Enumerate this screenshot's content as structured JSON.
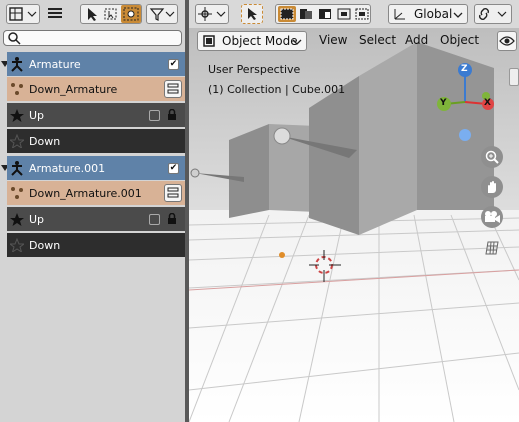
{
  "outliner": {
    "search_placeholder": "",
    "items": [
      {
        "label": "Armature",
        "kind": "armature"
      },
      {
        "label": "Down_Armature",
        "kind": "pose"
      },
      {
        "label": "Up",
        "kind": "bone"
      },
      {
        "label": "Down",
        "kind": "bone"
      },
      {
        "label": "Armature.001",
        "kind": "armature"
      },
      {
        "label": "Down_Armature.001",
        "kind": "pose"
      },
      {
        "label": "Up",
        "kind": "bone"
      },
      {
        "label": "Down",
        "kind": "bone"
      }
    ]
  },
  "viewport_header": {
    "orientation": "Global",
    "mode": "Object Mode",
    "menus": [
      "View",
      "Select",
      "Add",
      "Object"
    ]
  },
  "overlay": {
    "perspective": "User Perspective",
    "collection": "(1) Collection | Cube.001"
  },
  "gizmo": {
    "x": "X",
    "y": "Y",
    "z": "Z"
  },
  "colors": {
    "armature_row": "#5f82a8",
    "selected_row": "#d8b296",
    "accent": "#c98a35"
  }
}
